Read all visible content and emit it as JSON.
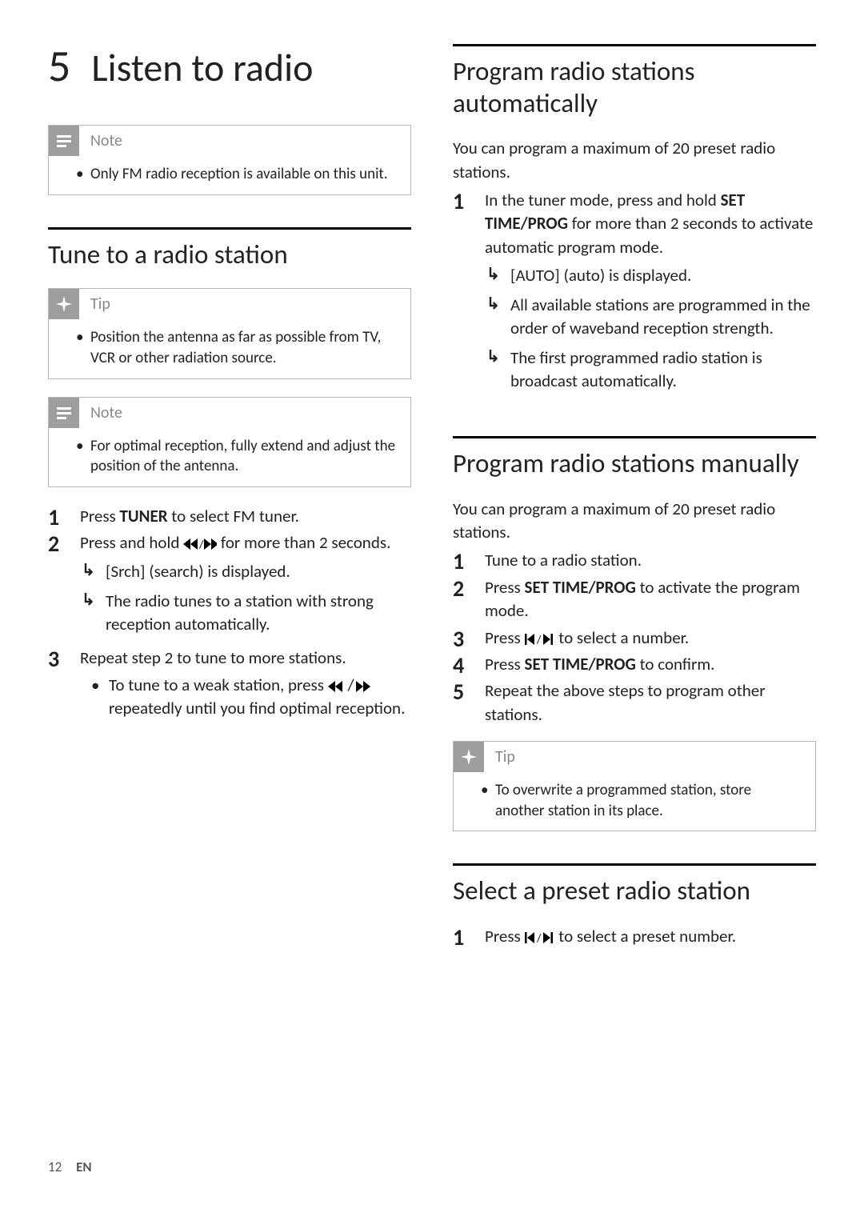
{
  "chapter": {
    "number": "5",
    "title": "Listen to radio"
  },
  "note1": {
    "label": "Note",
    "items": [
      "Only FM radio reception is available on this unit."
    ]
  },
  "tune": {
    "title": "Tune to a radio station",
    "tip": {
      "label": "Tip",
      "items": [
        "Position the antenna as far as possible from TV, VCR or other radiation source."
      ]
    },
    "note": {
      "label": "Note",
      "items": [
        "For optimal reception, fully extend and adjust the position of the antenna."
      ]
    },
    "steps": {
      "s1a": "Press ",
      "s1b": "TUNER",
      "s1c": " to select FM tuner.",
      "s2a": "Press and hold ",
      "s2b": " for more than 2 seconds.",
      "s2r1": "[Srch] (search) is displayed.",
      "s2r2": "The radio tunes to a station with strong reception automatically.",
      "s3": "Repeat step 2 to tune to more stations.",
      "s3sub_a": "To tune to a weak station, press ",
      "s3sub_b": " repeatedly until you find optimal reception."
    }
  },
  "auto": {
    "title": "Program radio stations automatically",
    "intro": "You can program a maximum of 20 preset radio stations.",
    "steps": {
      "s1a": "In the tuner mode, press and hold ",
      "s1b": "SET TIME/PROG",
      "s1c": " for more than 2 seconds to activate automatic program mode.",
      "s1r1": "[AUTO] (auto) is displayed.",
      "s1r2": "All available stations are programmed in the order of waveband reception strength.",
      "s1r3": "The first programmed radio station is broadcast automatically."
    }
  },
  "manual": {
    "title": "Program radio stations manually",
    "intro": "You can program a maximum of 20 preset radio stations.",
    "steps": {
      "s1": "Tune to a radio station.",
      "s2a": "Press ",
      "s2b": "SET TIME/PROG",
      "s2c": " to activate the program mode.",
      "s3a": "Press ",
      "s3b": " to select a number.",
      "s4a": "Press ",
      "s4b": "SET TIME/PROG",
      "s4c": " to confirm.",
      "s5": "Repeat the above steps to program other stations."
    },
    "tip": {
      "label": "Tip",
      "items": [
        "To overwrite a programmed station, store another station in its place."
      ]
    }
  },
  "select": {
    "title": "Select a preset radio station",
    "steps": {
      "s1a": "Press ",
      "s1b": " to select a preset number."
    }
  },
  "footer": {
    "page": "12",
    "lang": "EN"
  },
  "icons": {
    "note": "note-icon",
    "tip": "tip-icon",
    "rew_fwd": "rewind-fastforward-icon",
    "rew": "rewind-icon",
    "fwd": "fastforward-icon",
    "prev_next": "skip-prev-next-icon",
    "slash": "/"
  }
}
